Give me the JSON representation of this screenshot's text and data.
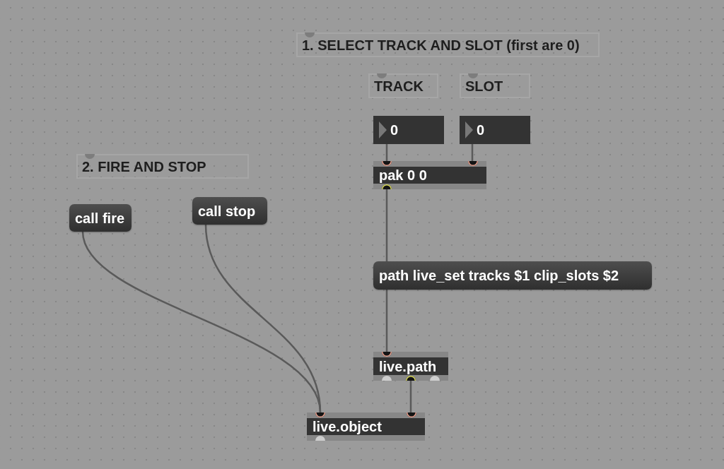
{
  "patcher": {
    "boxes": [
      {
        "kind": "comment",
        "text": "1. SELECT TRACK AND SLOT (first are 0)",
        "inlets": [
          {
            "connected": false
          }
        ]
      },
      {
        "kind": "comment",
        "text": "TRACK",
        "inlets": [
          {
            "connected": false
          }
        ]
      },
      {
        "kind": "comment",
        "text": "SLOT",
        "inlets": [
          {
            "connected": false
          }
        ]
      },
      {
        "kind": "number",
        "value": "0"
      },
      {
        "kind": "number",
        "value": "0"
      },
      {
        "kind": "comment",
        "text": "2. FIRE AND STOP",
        "inlets": [
          {
            "connected": false
          }
        ]
      },
      {
        "kind": "object",
        "text": "pak 0 0",
        "inlets": [
          {
            "connected": true
          },
          {
            "connected": true
          }
        ],
        "outlets": [
          {
            "connected": true
          }
        ]
      },
      {
        "kind": "message",
        "text": "call stop"
      },
      {
        "kind": "message",
        "text": "call fire"
      },
      {
        "kind": "message",
        "text": "path live_set tracks $1 clip_slots $2"
      },
      {
        "kind": "object",
        "text": "live.path",
        "inlets": [
          {
            "connected": true
          }
        ],
        "outlets": [
          {
            "connected": false
          },
          {
            "connected": true
          },
          {
            "connected": false
          }
        ]
      },
      {
        "kind": "object",
        "text": "live.object",
        "inlets": [
          {
            "connected": true
          },
          {
            "connected": true
          }
        ],
        "outlets": [
          {
            "connected": false
          }
        ]
      }
    ]
  }
}
